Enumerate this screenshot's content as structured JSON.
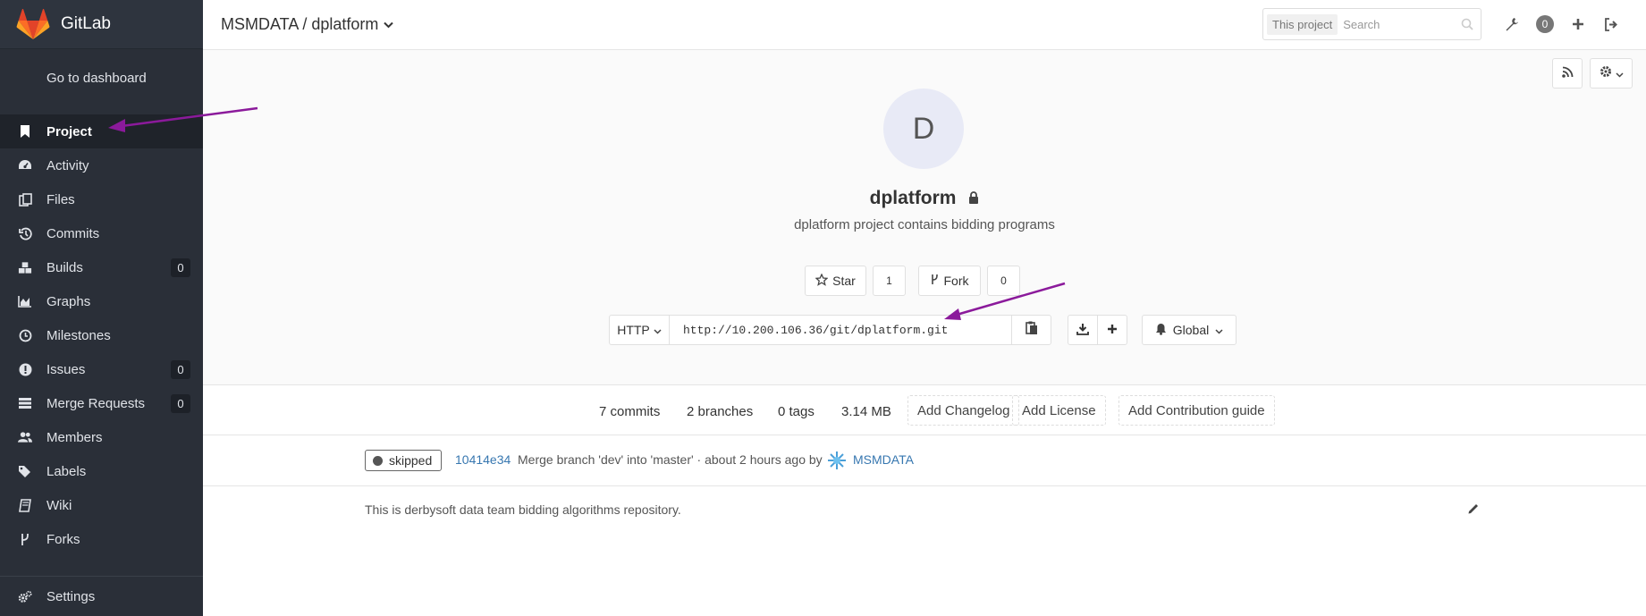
{
  "brand": {
    "name": "GitLab"
  },
  "sidebar": {
    "dashboard_link": "Go to dashboard",
    "items": [
      {
        "label": "Project",
        "icon": "bookmark-icon",
        "active": true
      },
      {
        "label": "Activity",
        "icon": "dashboard-icon"
      },
      {
        "label": "Files",
        "icon": "files-icon"
      },
      {
        "label": "Commits",
        "icon": "history-icon"
      },
      {
        "label": "Builds",
        "icon": "cubes-icon",
        "count": "0"
      },
      {
        "label": "Graphs",
        "icon": "area-chart-icon"
      },
      {
        "label": "Milestones",
        "icon": "clock-icon"
      },
      {
        "label": "Issues",
        "icon": "exclamation-circle-icon",
        "count": "0"
      },
      {
        "label": "Merge Requests",
        "icon": "tasks-icon",
        "count": "0"
      },
      {
        "label": "Members",
        "icon": "users-icon"
      },
      {
        "label": "Labels",
        "icon": "tags-icon"
      },
      {
        "label": "Wiki",
        "icon": "book-icon"
      },
      {
        "label": "Forks",
        "icon": "code-fork-icon"
      }
    ],
    "settings_label": "Settings"
  },
  "header": {
    "breadcrumb": "MSMDATA / dplatform",
    "search_scope": "This project",
    "search_placeholder": "Search",
    "todo_count": "0"
  },
  "project": {
    "avatar_letter": "D",
    "name": "dplatform",
    "description": "dplatform project contains bidding programs",
    "star_label": "Star",
    "star_count": "1",
    "fork_label": "Fork",
    "fork_count": "0",
    "clone_protocol": "HTTP",
    "clone_url": "http://10.200.106.36/git/dplatform.git",
    "notification_level": "Global"
  },
  "stats": {
    "commits": "7 commits",
    "branches": "2 branches",
    "tags": "0 tags",
    "size": "3.14 MB",
    "add_changelog": "Add Changelog",
    "add_license": "Add License",
    "add_contribution": "Add Contribution guide"
  },
  "last_commit": {
    "status": "skipped",
    "sha": "10414e34",
    "message": "Merge branch 'dev' into 'master' · about 2 hours ago by",
    "author": "MSMDATA"
  },
  "readme": {
    "text": "This is derbysoft data team bidding algorithms repository."
  },
  "colors": {
    "sidebar_bg": "#2a2f38",
    "link": "#3777b0",
    "annotation_arrow": "#8b1a9b"
  }
}
